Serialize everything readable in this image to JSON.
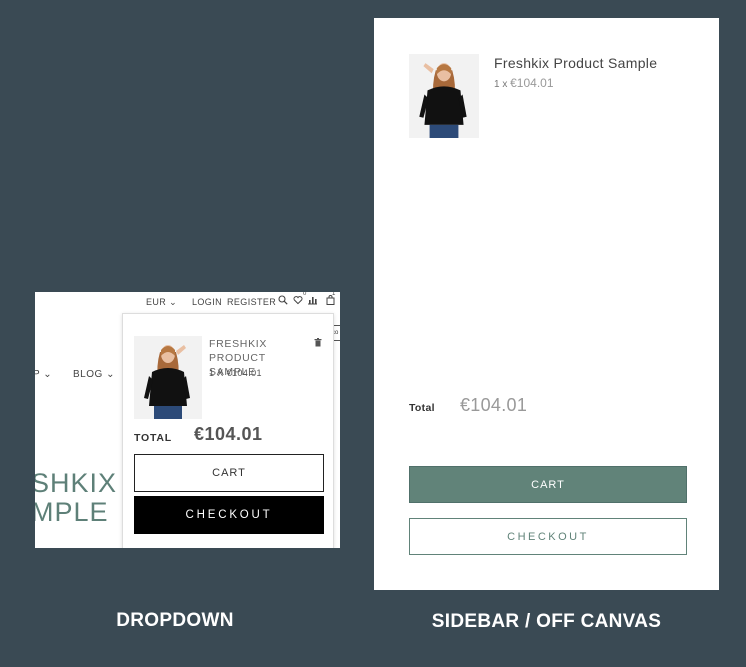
{
  "dropdown": {
    "caption": "DROPDOWN",
    "topbar": {
      "currency": "EUR ⌄",
      "login": "LOGIN",
      "register": "REGISTER",
      "wishlist_count": "0",
      "cart_count": "1"
    },
    "nav": {
      "fragment_1": "P ⌄",
      "blog": "BLOG ⌄"
    },
    "hero_text": "SHKIX\nMPLE",
    "side_tab_label": "co",
    "cart_panel": {
      "product_name": "FRESHKIX PRODUCT SAMPLE",
      "quantity_price": "1 X €104.01",
      "total_label": "TOTAL",
      "total_amount": "€104.01",
      "cart_button": "CART",
      "checkout_button": "CHECKOUT"
    }
  },
  "sidebar": {
    "caption": "SIDEBAR / OFF CANVAS",
    "product_name": "Freshkix Product Sample",
    "quantity": "1 x",
    "price": "€104.01",
    "total_label": "Total",
    "total_amount": "€104.01",
    "cart_button": "CART",
    "checkout_button": "CHECKOUT"
  },
  "colors": {
    "background": "#3a4a54",
    "accent_green": "#618379",
    "checkout_black": "#000000"
  },
  "icons": [
    "search-icon",
    "heart-icon",
    "chart-icon",
    "shopping-bag-icon",
    "trash-icon"
  ]
}
